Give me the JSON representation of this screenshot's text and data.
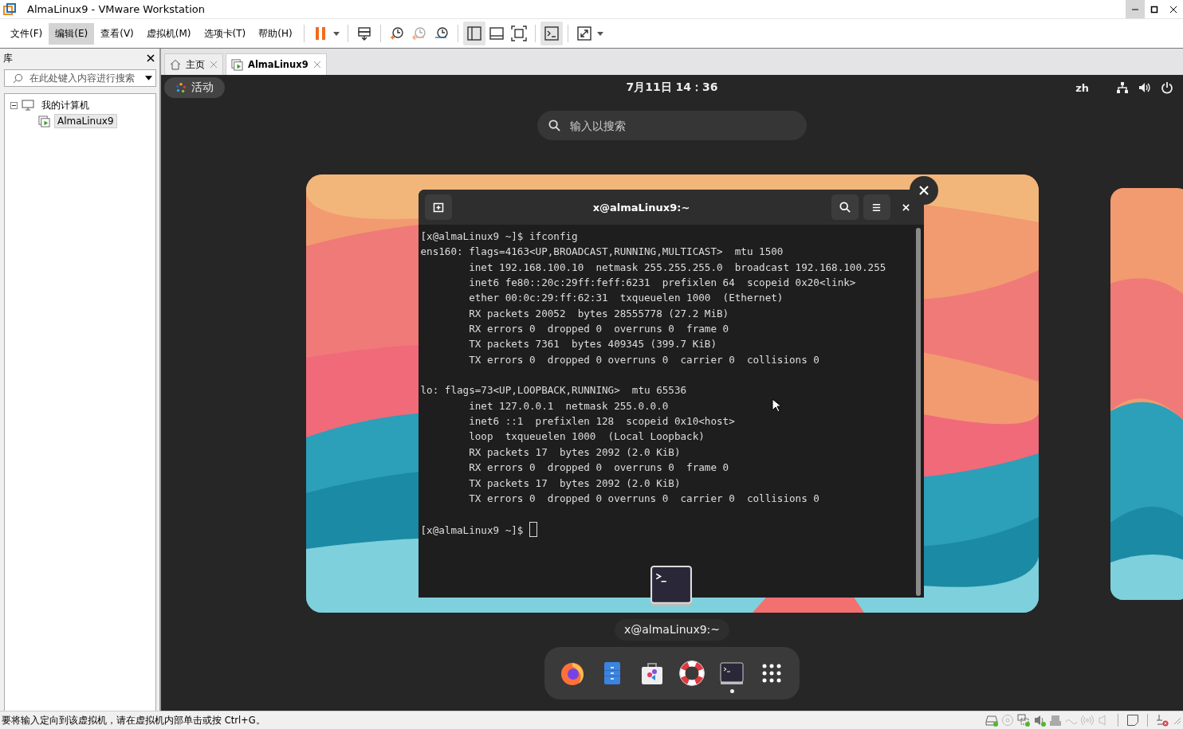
{
  "window": {
    "title": "AlmaLinux9 - VMware Workstation"
  },
  "menu": [
    {
      "label": "文件(F)",
      "selected": false
    },
    {
      "label": "编辑(E)",
      "selected": true
    },
    {
      "label": "查看(V)",
      "selected": false
    },
    {
      "label": "虚拟机(M)",
      "selected": false
    },
    {
      "label": "选项卡(T)",
      "selected": false
    },
    {
      "label": "帮助(H)",
      "selected": false
    }
  ],
  "toolbar": [
    [
      {
        "kind": "pause",
        "dropdown": true,
        "selected": false
      }
    ],
    [
      {
        "kind": "send-keys",
        "dropdown": false,
        "selected": false
      }
    ],
    [
      {
        "kind": "snapshot-take",
        "dropdown": false,
        "selected": false
      },
      {
        "kind": "snapshot-revert",
        "dropdown": false,
        "selected": false
      },
      {
        "kind": "snapshot-manager",
        "dropdown": false,
        "selected": false
      }
    ],
    [
      {
        "kind": "view-library",
        "dropdown": false,
        "selected": true
      },
      {
        "kind": "view-thumbnail",
        "dropdown": false,
        "selected": false
      },
      {
        "kind": "view-fullscreen",
        "dropdown": false,
        "selected": false
      }
    ],
    [
      {
        "kind": "console",
        "dropdown": false,
        "selected": true
      }
    ],
    [
      {
        "kind": "stretch",
        "dropdown": true,
        "selected": false
      }
    ]
  ],
  "library": {
    "title": "库",
    "search": {
      "placeholder": "在此处键入内容进行搜索"
    },
    "tree": [
      {
        "label": "我的计算机",
        "expanded": true,
        "selected": false,
        "children": [
          {
            "label": "AlmaLinux9",
            "selected": true
          }
        ]
      }
    ]
  },
  "tabs": [
    {
      "label": "主页",
      "kind": "home",
      "selected": false
    },
    {
      "label": "AlmaLinux9",
      "kind": "vm",
      "selected": true
    }
  ],
  "guest": {
    "activities": "活动",
    "clock": "7月11日 14：36",
    "language": "zh",
    "search": {
      "placeholder": "输入以搜索"
    },
    "terminal": {
      "title": "x@almaLinux9:~",
      "blocks": [
        [
          "[x@almaLinux9 ~]$ ifconfig",
          "ens160: flags=4163<UP,BROADCAST,RUNNING,MULTICAST>  mtu 1500",
          "        inet 192.168.100.10  netmask 255.255.255.0  broadcast 192.168.100.255",
          "        inet6 fe80::20c:29ff:feff:6231  prefixlen 64  scopeid 0x20<link>",
          "        ether 00:0c:29:ff:62:31  txqueuelen 1000  (Ethernet)",
          "        RX packets 20052  bytes 28555778 (27.2 MiB)",
          "        RX errors 0  dropped 0  overruns 0  frame 0",
          "        TX packets 7361  bytes 409345 (399.7 KiB)",
          "        TX errors 0  dropped 0 overruns 0  carrier 0  collisions 0"
        ],
        [
          "lo: flags=73<UP,LOOPBACK,RUNNING>  mtu 65536",
          "        inet 127.0.0.1  netmask 255.0.0.0",
          "        inet6 ::1  prefixlen 128  scopeid 0x10<host>",
          "        loop  txqueuelen 1000  (Local Loopback)",
          "        RX packets 17  bytes 2092 (2.0 KiB)",
          "        RX errors 0  dropped 0  overruns 0  frame 0",
          "        TX packets 17  bytes 2092 (2.0 KiB)",
          "        TX errors 0  dropped 0 overruns 0  carrier 0  collisions 0"
        ]
      ],
      "prompt": "[x@almaLinux9 ~]$ "
    },
    "window_label": "x@almaLinux9:~",
    "dock": [
      {
        "kind": "firefox",
        "running": false
      },
      {
        "kind": "files",
        "running": false
      },
      {
        "kind": "software",
        "running": false
      },
      {
        "kind": "help",
        "running": false
      },
      {
        "kind": "terminal",
        "running": true
      },
      {
        "kind": "apps",
        "running": false
      }
    ]
  },
  "status_bar": {
    "message": "要将输入定向到该虚拟机，请在虚拟机内部单击或按 Ctrl+G。",
    "devices": [
      {
        "kind": "disk",
        "active": true
      },
      {
        "kind": "cd",
        "active": false
      },
      {
        "kind": "network",
        "active": true
      },
      {
        "kind": "sound",
        "active": true
      },
      {
        "kind": "usb",
        "active": false
      },
      {
        "kind": "serial",
        "active": false
      },
      {
        "kind": "wireless",
        "active": false
      },
      {
        "kind": "speaker",
        "active": false
      }
    ]
  }
}
